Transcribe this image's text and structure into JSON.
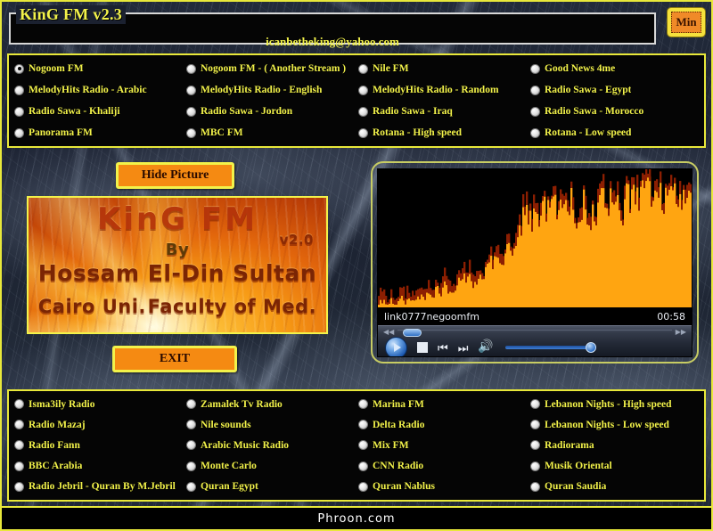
{
  "window": {
    "title": "KinG FM v2.3",
    "email": "icanbetheking@yahoo.com",
    "minimize_label": "Min"
  },
  "colors": {
    "accent_yellow": "#f2f24a",
    "button_orange": "#f58a12",
    "panel_black": "#050505",
    "background_navy": "#1b2130",
    "spectrum_orange": "#ffa511"
  },
  "stations_top": [
    {
      "label": "Nogoom FM",
      "selected": true
    },
    {
      "label": "Nogoom FM - ( Another Stream )",
      "selected": false
    },
    {
      "label": "Nile FM",
      "selected": false
    },
    {
      "label": "Good News 4me",
      "selected": false
    },
    {
      "label": "MelodyHits Radio - Arabic",
      "selected": false
    },
    {
      "label": "MelodyHits Radio - English",
      "selected": false
    },
    {
      "label": "MelodyHits Radio - Random",
      "selected": false
    },
    {
      "label": "Radio Sawa - Egypt",
      "selected": false
    },
    {
      "label": "Radio Sawa - Khaliji",
      "selected": false
    },
    {
      "label": "Radio Sawa - Jordon",
      "selected": false
    },
    {
      "label": "Radio Sawa - Iraq",
      "selected": false
    },
    {
      "label": "Radio Sawa - Morocco",
      "selected": false
    },
    {
      "label": "Panorama FM",
      "selected": false
    },
    {
      "label": "MBC FM",
      "selected": false
    },
    {
      "label": "Rotana - High speed",
      "selected": false
    },
    {
      "label": "Rotana - Low speed",
      "selected": false
    }
  ],
  "stations_bottom": [
    {
      "label": "Isma3ily Radio",
      "selected": false
    },
    {
      "label": "Zamalek Tv Radio",
      "selected": false
    },
    {
      "label": "Marina FM",
      "selected": false
    },
    {
      "label": "Lebanon Nights - High speed",
      "selected": false
    },
    {
      "label": "Radio Mazaj",
      "selected": false
    },
    {
      "label": "Nile sounds",
      "selected": false
    },
    {
      "label": "Delta Radio",
      "selected": false
    },
    {
      "label": "Lebanon Nights - Low speed",
      "selected": false
    },
    {
      "label": "Radio Fann",
      "selected": false
    },
    {
      "label": "Arabic Music Radio",
      "selected": false
    },
    {
      "label": "Mix FM",
      "selected": false
    },
    {
      "label": "Radiorama",
      "selected": false
    },
    {
      "label": "BBC Arabia",
      "selected": false
    },
    {
      "label": "Monte Carlo",
      "selected": false
    },
    {
      "label": "CNN Radio",
      "selected": false
    },
    {
      "label": "Musik Oriental",
      "selected": false
    },
    {
      "label": "Radio Jebril - Quran By M.Jebril",
      "selected": false
    },
    {
      "label": "Quran Egypt",
      "selected": false
    },
    {
      "label": "Quran Nablus",
      "selected": false
    },
    {
      "label": "Quran Saudia",
      "selected": false
    }
  ],
  "buttons": {
    "hide_picture": "Hide Picture",
    "exit": "EXIT"
  },
  "picture": {
    "title": "KinG FM",
    "version": "v2.0",
    "by": "By",
    "author": "Hossam El-Din Sultan",
    "affiliation_left": "Cairo Uni.",
    "affiliation_right": "Faculty of Med."
  },
  "player": {
    "stream_title": "link0777negoomfm",
    "elapsed": "00:58",
    "play_label": "Play",
    "stop_label": "Stop",
    "prev_label": "Previous",
    "next_label": "Next",
    "mute_label": "Mute",
    "volume_percent": 100,
    "seek_percent": 2
  },
  "footer": {
    "text": "Phroon.com"
  }
}
